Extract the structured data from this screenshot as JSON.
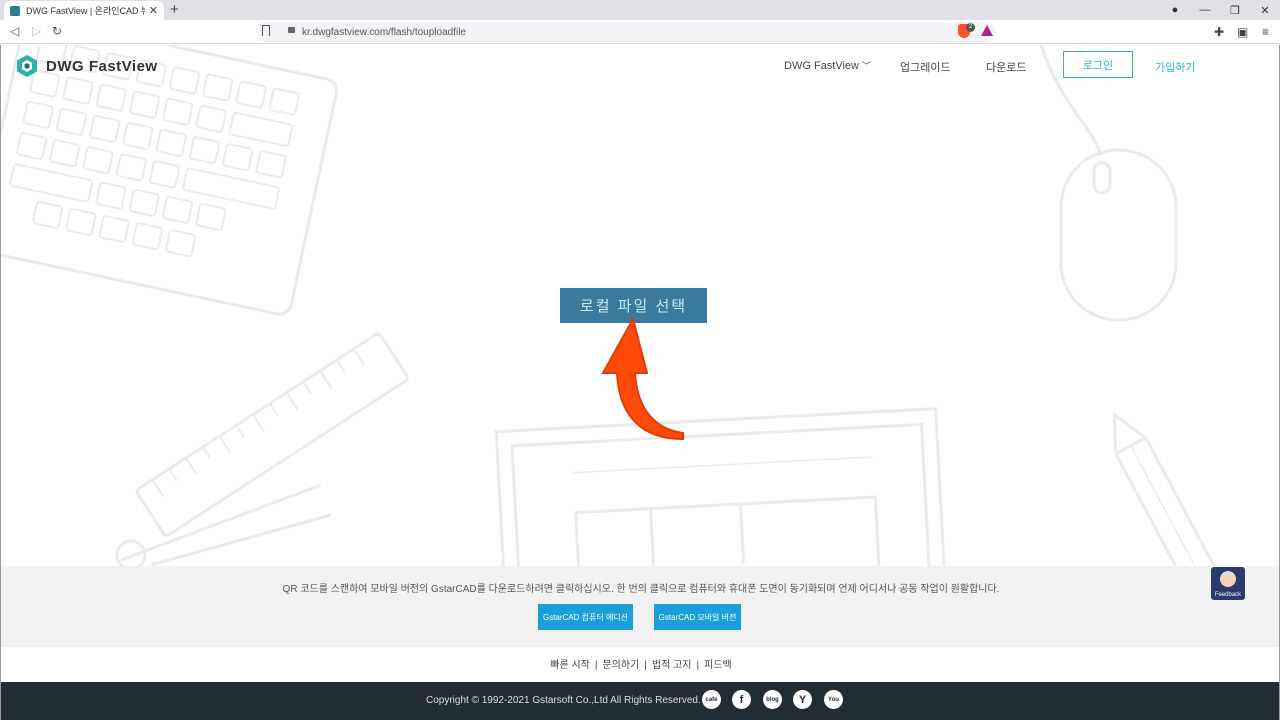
{
  "browser": {
    "tab_title": "DWG FastView | 온라인CAD 뷰어",
    "url": "kr.dwgfastview.com/flash/touploadfile",
    "brave_badge": "2"
  },
  "header": {
    "logo_text": "DWG FastView",
    "nav": {
      "dwg": "DWG FastView",
      "upgrade": "업그레이드",
      "download": "다운로드",
      "login": "로그인",
      "signup": "가입하기"
    }
  },
  "main": {
    "select_button": "로컬 파일 선택",
    "accent_color": "#3a7a9c",
    "arrow_color": "#ff4a0a"
  },
  "qr": {
    "text": "QR 코드를 스캔하여 모바일 버전의 GstarCAD를 다운로드하려면 클릭하십시오. 한 번의 클릭으로 컴퓨터와 휴대폰 도면이 동기화되며 언제 어디서나 공동 작업이 원활합니다.",
    "btn_pc": "GstarCAD 컴퓨터 에디션",
    "btn_mobile": "GstarCAD 모바일 버전",
    "feedback": "Feedback"
  },
  "links": [
    "빠른 시작",
    "문의하기",
    "법적 고지",
    "피드백"
  ],
  "footer": {
    "copyright": "Copyright © 1992-2021 Gstarsoft Co.,Ltd All Rights Reserved.",
    "social": [
      "cafe",
      "f",
      "blog",
      "Y",
      "You"
    ]
  }
}
